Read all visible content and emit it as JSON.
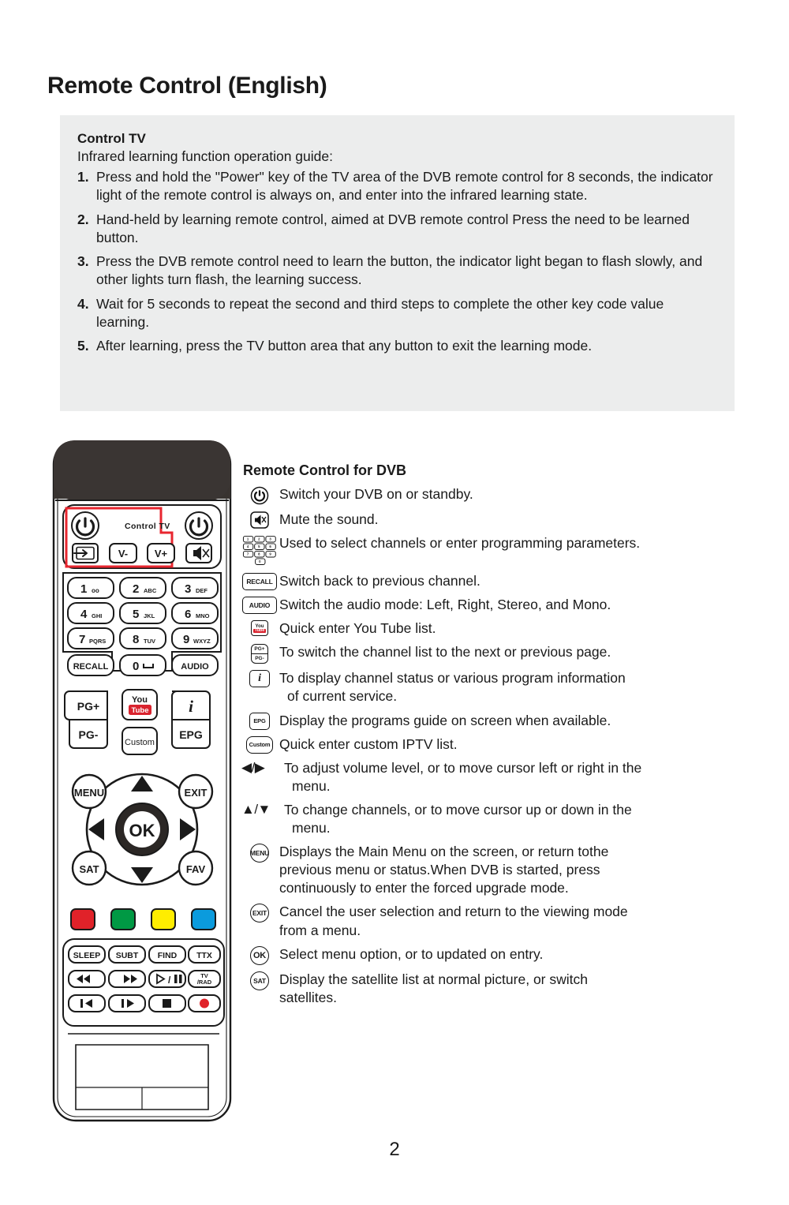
{
  "page": {
    "title": "Remote Control (English)",
    "number": "2"
  },
  "info_panel": {
    "heading": "Control TV",
    "subheading": "Infrared learning function operation guide:",
    "steps": [
      {
        "num": "1.",
        "text": "Press and hold the \"Power\" key of the TV area of the DVB remote control for 8 seconds, the indicator light of the remote control is always on, and enter into the infrared learning state."
      },
      {
        "num": "2.",
        "text": "Hand-held by learning remote control, aimed at DVB remote control Press the need to be learned button."
      },
      {
        "num": "3.",
        "text": "Press the DVB remote control need to learn the button, the indicator light began to flash slowly, and other lights turn flash, the learning success."
      },
      {
        "num": "4.",
        "text": "Wait for 5 seconds to repeat the second and third steps to complete the other key code value learning."
      },
      {
        "num": "5.",
        "text": "After learning, press the TV button area that any button to exit the learning mode."
      }
    ]
  },
  "remote": {
    "control_tv_label": "Control TV",
    "highlight_color": "#e8262f",
    "top_row": [
      "power-tv",
      "Control TV",
      "power-dvb"
    ],
    "second_row": [
      "input-source",
      "V-",
      "V+",
      "mute"
    ],
    "keypad": [
      {
        "digit": "1",
        "letters": "oo"
      },
      {
        "digit": "2",
        "letters": "ABC"
      },
      {
        "digit": "3",
        "letters": "DEF"
      },
      {
        "digit": "4",
        "letters": "GHI"
      },
      {
        "digit": "5",
        "letters": "JKL"
      },
      {
        "digit": "6",
        "letters": "MNO"
      },
      {
        "digit": "7",
        "letters": "PQRS"
      },
      {
        "digit": "8",
        "letters": "TUV"
      },
      {
        "digit": "9",
        "letters": "WXYZ"
      }
    ],
    "keypad_bottom": [
      "RECALL",
      "0",
      "AUDIO"
    ],
    "fn_left": [
      "PG+",
      "PG-"
    ],
    "fn_mid_youtube": {
      "you": "You",
      "tube": "Tube"
    },
    "fn_mid_custom": "Custom",
    "fn_right": [
      "i",
      "EPG"
    ],
    "nav": {
      "menu": "MENU",
      "exit": "EXIT",
      "ok": "OK",
      "sat": "SAT",
      "fav": "FAV"
    },
    "color_buttons": [
      {
        "name": "red",
        "hex": "#e02229"
      },
      {
        "name": "green",
        "hex": "#009944"
      },
      {
        "name": "yellow",
        "hex": "#ffed00"
      },
      {
        "name": "blue",
        "hex": "#0b9bdd"
      }
    ],
    "media_row1": [
      "SLEEP",
      "SUBT",
      "FIND",
      "TTX"
    ],
    "media_row2": [
      "rewind",
      "fast-forward",
      "play-pause",
      "TV /RAD"
    ],
    "media_row3": [
      "step-back",
      "step-forward",
      "stop",
      "record"
    ],
    "tv_rad_label_top": "TV",
    "tv_rad_label_bottom": "/RAD"
  },
  "legend": {
    "title": "Remote Control for DVB",
    "items": [
      {
        "icon": "power-icon",
        "icon_label": "",
        "text": "Switch your DVB on or standby."
      },
      {
        "icon": "mute-icon",
        "icon_label": "",
        "text": "Mute the sound."
      },
      {
        "icon": "keypad-icon",
        "icon_label": "",
        "text": "Used to select channels or enter programming parameters."
      },
      {
        "icon": "recall-icon",
        "icon_label": "RECALL",
        "text": "Switch back to previous channel."
      },
      {
        "icon": "audio-icon",
        "icon_label": "AUDIO",
        "text": "Switch the audio mode: Left, Right, Stereo, and Mono."
      },
      {
        "icon": "youtube-icon",
        "icon_label": "",
        "text": "Quick enter You Tube list."
      },
      {
        "icon": "page-updown-icon",
        "icon_label": "PG+ / PG-",
        "text": "To switch the channel list to the next or previous page."
      },
      {
        "icon": "info-icon",
        "icon_label": "i",
        "text": "To display channel status or various program information",
        "text2": "of current service."
      },
      {
        "icon": "epg-icon",
        "icon_label": "EPG",
        "text": "Display the programs guide on screen when available."
      },
      {
        "icon": "custom-icon",
        "icon_label": "Custom",
        "text": "Quick enter custom IPTV list."
      },
      {
        "icon": "left-right-arrow-icon",
        "icon_label": "◀/▶",
        "text": "To adjust volume level, or to move cursor left or right in the",
        "text2": "menu."
      },
      {
        "icon": "up-down-arrow-icon",
        "icon_label": "▲/▼",
        "text": "To change channels, or to move cursor up or down  in the",
        "text2": "menu."
      },
      {
        "icon": "menu-icon",
        "icon_label": "MENU",
        "text": "Displays the Main Menu on the screen, or return tothe",
        "text2": "previous menu or status.When DVB is started, press",
        "text3": "continuously to enter the forced upgrade mode."
      },
      {
        "icon": "exit-icon",
        "icon_label": "EXIT",
        "text": "Cancel the user selection and return to the viewing mode",
        "text2": "from  a menu."
      },
      {
        "icon": "ok-icon",
        "icon_label": "OK",
        "text": "Select menu option, or to updated on entry."
      },
      {
        "icon": "sat-icon",
        "icon_label": "SAT",
        "text": "Display the satellite list at normal picture, or switch",
        "text2": "satellites."
      }
    ]
  }
}
